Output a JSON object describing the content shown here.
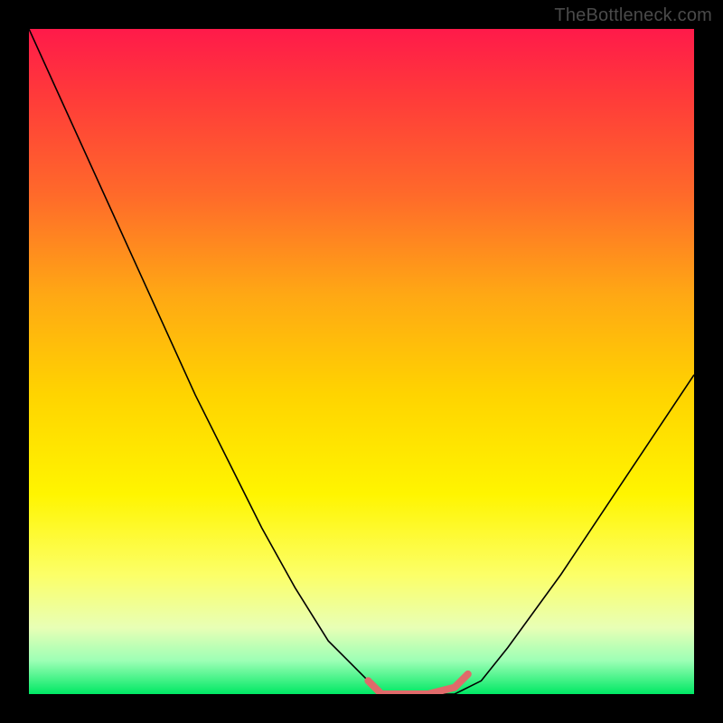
{
  "watermark": "TheBottleneck.com",
  "chart_data": {
    "type": "line",
    "title": "",
    "xlabel": "",
    "ylabel": "",
    "series": [
      {
        "name": "curve",
        "x": [
          0.0,
          0.05,
          0.1,
          0.15,
          0.2,
          0.25,
          0.3,
          0.35,
          0.4,
          0.45,
          0.5,
          0.53,
          0.56,
          0.6,
          0.64,
          0.68,
          0.72,
          0.8,
          0.9,
          1.0
        ],
        "y": [
          1.0,
          0.89,
          0.78,
          0.67,
          0.56,
          0.45,
          0.35,
          0.25,
          0.16,
          0.08,
          0.03,
          0.0,
          0.0,
          0.0,
          0.0,
          0.02,
          0.07,
          0.18,
          0.33,
          0.48
        ],
        "color": "#000000"
      },
      {
        "name": "highlight",
        "x": [
          0.51,
          0.53,
          0.56,
          0.6,
          0.64,
          0.66
        ],
        "y": [
          0.02,
          0.0,
          0.0,
          0.0,
          0.01,
          0.03
        ],
        "color": "#e06a6a"
      }
    ],
    "xlim": [
      0,
      1
    ],
    "ylim": [
      0,
      1
    ],
    "background_gradient": [
      "#ff1a4a",
      "#ffd400",
      "#00e864"
    ]
  }
}
